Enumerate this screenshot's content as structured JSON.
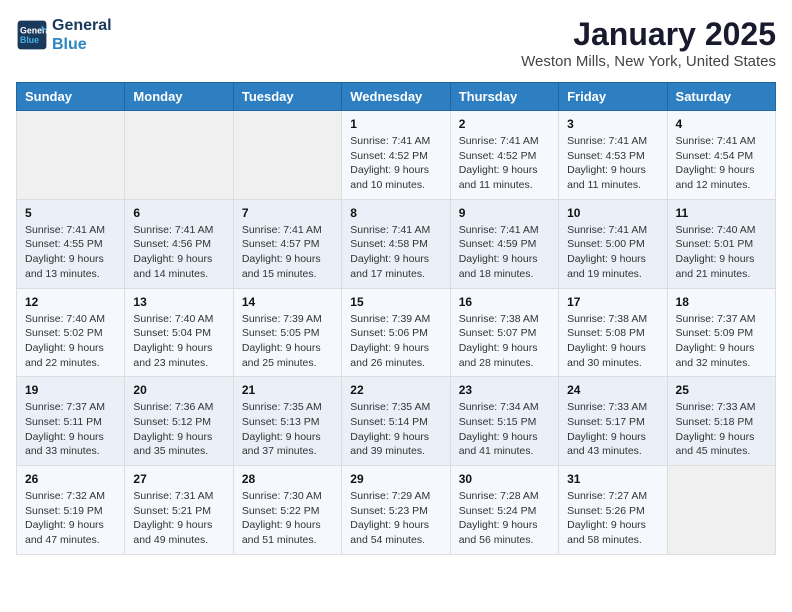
{
  "header": {
    "logo_line1": "General",
    "logo_line2": "Blue",
    "month": "January 2025",
    "location": "Weston Mills, New York, United States"
  },
  "weekdays": [
    "Sunday",
    "Monday",
    "Tuesday",
    "Wednesday",
    "Thursday",
    "Friday",
    "Saturday"
  ],
  "weeks": [
    [
      {
        "day": "",
        "sunrise": "",
        "sunset": "",
        "daylight": ""
      },
      {
        "day": "",
        "sunrise": "",
        "sunset": "",
        "daylight": ""
      },
      {
        "day": "",
        "sunrise": "",
        "sunset": "",
        "daylight": ""
      },
      {
        "day": "1",
        "sunrise": "Sunrise: 7:41 AM",
        "sunset": "Sunset: 4:52 PM",
        "daylight": "Daylight: 9 hours and 10 minutes."
      },
      {
        "day": "2",
        "sunrise": "Sunrise: 7:41 AM",
        "sunset": "Sunset: 4:52 PM",
        "daylight": "Daylight: 9 hours and 11 minutes."
      },
      {
        "day": "3",
        "sunrise": "Sunrise: 7:41 AM",
        "sunset": "Sunset: 4:53 PM",
        "daylight": "Daylight: 9 hours and 11 minutes."
      },
      {
        "day": "4",
        "sunrise": "Sunrise: 7:41 AM",
        "sunset": "Sunset: 4:54 PM",
        "daylight": "Daylight: 9 hours and 12 minutes."
      }
    ],
    [
      {
        "day": "5",
        "sunrise": "Sunrise: 7:41 AM",
        "sunset": "Sunset: 4:55 PM",
        "daylight": "Daylight: 9 hours and 13 minutes."
      },
      {
        "day": "6",
        "sunrise": "Sunrise: 7:41 AM",
        "sunset": "Sunset: 4:56 PM",
        "daylight": "Daylight: 9 hours and 14 minutes."
      },
      {
        "day": "7",
        "sunrise": "Sunrise: 7:41 AM",
        "sunset": "Sunset: 4:57 PM",
        "daylight": "Daylight: 9 hours and 15 minutes."
      },
      {
        "day": "8",
        "sunrise": "Sunrise: 7:41 AM",
        "sunset": "Sunset: 4:58 PM",
        "daylight": "Daylight: 9 hours and 17 minutes."
      },
      {
        "day": "9",
        "sunrise": "Sunrise: 7:41 AM",
        "sunset": "Sunset: 4:59 PM",
        "daylight": "Daylight: 9 hours and 18 minutes."
      },
      {
        "day": "10",
        "sunrise": "Sunrise: 7:41 AM",
        "sunset": "Sunset: 5:00 PM",
        "daylight": "Daylight: 9 hours and 19 minutes."
      },
      {
        "day": "11",
        "sunrise": "Sunrise: 7:40 AM",
        "sunset": "Sunset: 5:01 PM",
        "daylight": "Daylight: 9 hours and 21 minutes."
      }
    ],
    [
      {
        "day": "12",
        "sunrise": "Sunrise: 7:40 AM",
        "sunset": "Sunset: 5:02 PM",
        "daylight": "Daylight: 9 hours and 22 minutes."
      },
      {
        "day": "13",
        "sunrise": "Sunrise: 7:40 AM",
        "sunset": "Sunset: 5:04 PM",
        "daylight": "Daylight: 9 hours and 23 minutes."
      },
      {
        "day": "14",
        "sunrise": "Sunrise: 7:39 AM",
        "sunset": "Sunset: 5:05 PM",
        "daylight": "Daylight: 9 hours and 25 minutes."
      },
      {
        "day": "15",
        "sunrise": "Sunrise: 7:39 AM",
        "sunset": "Sunset: 5:06 PM",
        "daylight": "Daylight: 9 hours and 26 minutes."
      },
      {
        "day": "16",
        "sunrise": "Sunrise: 7:38 AM",
        "sunset": "Sunset: 5:07 PM",
        "daylight": "Daylight: 9 hours and 28 minutes."
      },
      {
        "day": "17",
        "sunrise": "Sunrise: 7:38 AM",
        "sunset": "Sunset: 5:08 PM",
        "daylight": "Daylight: 9 hours and 30 minutes."
      },
      {
        "day": "18",
        "sunrise": "Sunrise: 7:37 AM",
        "sunset": "Sunset: 5:09 PM",
        "daylight": "Daylight: 9 hours and 32 minutes."
      }
    ],
    [
      {
        "day": "19",
        "sunrise": "Sunrise: 7:37 AM",
        "sunset": "Sunset: 5:11 PM",
        "daylight": "Daylight: 9 hours and 33 minutes."
      },
      {
        "day": "20",
        "sunrise": "Sunrise: 7:36 AM",
        "sunset": "Sunset: 5:12 PM",
        "daylight": "Daylight: 9 hours and 35 minutes."
      },
      {
        "day": "21",
        "sunrise": "Sunrise: 7:35 AM",
        "sunset": "Sunset: 5:13 PM",
        "daylight": "Daylight: 9 hours and 37 minutes."
      },
      {
        "day": "22",
        "sunrise": "Sunrise: 7:35 AM",
        "sunset": "Sunset: 5:14 PM",
        "daylight": "Daylight: 9 hours and 39 minutes."
      },
      {
        "day": "23",
        "sunrise": "Sunrise: 7:34 AM",
        "sunset": "Sunset: 5:15 PM",
        "daylight": "Daylight: 9 hours and 41 minutes."
      },
      {
        "day": "24",
        "sunrise": "Sunrise: 7:33 AM",
        "sunset": "Sunset: 5:17 PM",
        "daylight": "Daylight: 9 hours and 43 minutes."
      },
      {
        "day": "25",
        "sunrise": "Sunrise: 7:33 AM",
        "sunset": "Sunset: 5:18 PM",
        "daylight": "Daylight: 9 hours and 45 minutes."
      }
    ],
    [
      {
        "day": "26",
        "sunrise": "Sunrise: 7:32 AM",
        "sunset": "Sunset: 5:19 PM",
        "daylight": "Daylight: 9 hours and 47 minutes."
      },
      {
        "day": "27",
        "sunrise": "Sunrise: 7:31 AM",
        "sunset": "Sunset: 5:21 PM",
        "daylight": "Daylight: 9 hours and 49 minutes."
      },
      {
        "day": "28",
        "sunrise": "Sunrise: 7:30 AM",
        "sunset": "Sunset: 5:22 PM",
        "daylight": "Daylight: 9 hours and 51 minutes."
      },
      {
        "day": "29",
        "sunrise": "Sunrise: 7:29 AM",
        "sunset": "Sunset: 5:23 PM",
        "daylight": "Daylight: 9 hours and 54 minutes."
      },
      {
        "day": "30",
        "sunrise": "Sunrise: 7:28 AM",
        "sunset": "Sunset: 5:24 PM",
        "daylight": "Daylight: 9 hours and 56 minutes."
      },
      {
        "day": "31",
        "sunrise": "Sunrise: 7:27 AM",
        "sunset": "Sunset: 5:26 PM",
        "daylight": "Daylight: 9 hours and 58 minutes."
      },
      {
        "day": "",
        "sunrise": "",
        "sunset": "",
        "daylight": ""
      }
    ]
  ]
}
